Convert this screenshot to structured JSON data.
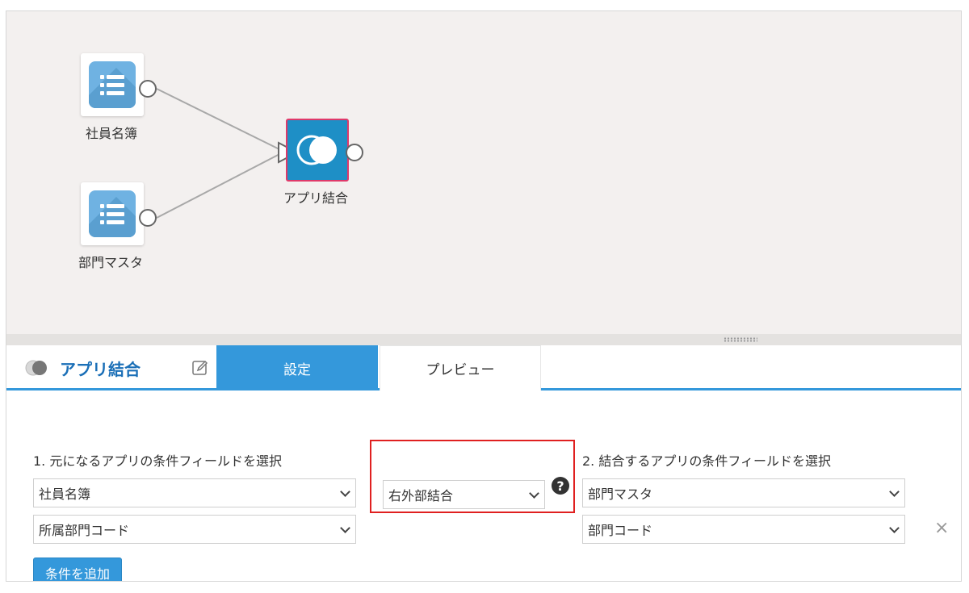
{
  "canvas": {
    "nodes": {
      "employees": {
        "label": "社員名簿",
        "icon": "app-list-icon"
      },
      "departments": {
        "label": "部門マスタ",
        "icon": "app-list-icon"
      },
      "join": {
        "label": "アプリ結合",
        "icon": "join-circles-icon"
      }
    },
    "colors": {
      "canvas_bg": "#f3f0ef",
      "join_fill": "#1e8fc6",
      "join_border": "#e0396a",
      "app_icon": "#6fb2e2"
    }
  },
  "panel": {
    "title": "アプリ結合",
    "title_icon": "join-circles-icon",
    "edit_icon": "pencil-icon",
    "tabs": {
      "settings": "設定",
      "preview": "プレビュー"
    },
    "section1_label": "1. 元になるアプリの条件フィールドを選択",
    "section2_label": "2. 結合するアプリの条件フィールドを選択",
    "left_app": "社員名簿",
    "left_field": "所属部門コード",
    "join_type": "右外部結合",
    "right_app": "部門マスタ",
    "right_field": "部門コード",
    "help_glyph": "?",
    "add_condition": "条件を追加",
    "remove_glyph": "×",
    "colors": {
      "accent": "#3498db",
      "highlight": "#e02020",
      "title": "#1a6fb7"
    }
  }
}
